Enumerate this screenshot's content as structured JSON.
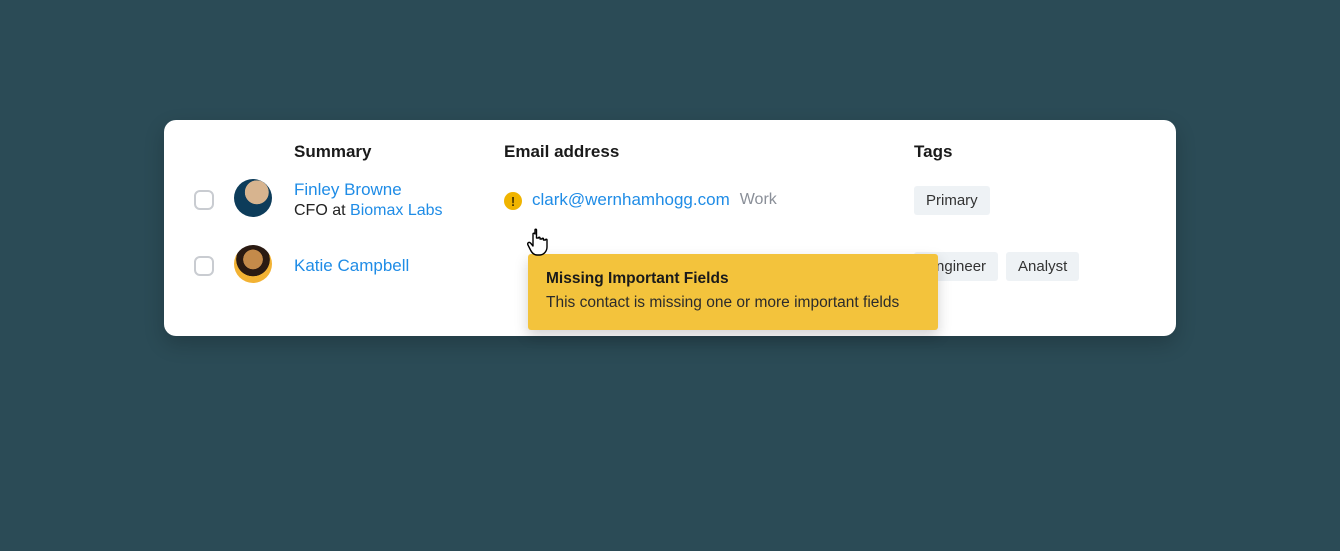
{
  "table": {
    "headers": {
      "summary": "Summary",
      "email": "Email address",
      "tags": "Tags"
    },
    "rows": [
      {
        "name": "Finley Browne",
        "role_prefix": "CFO at ",
        "company": "Biomax Labs",
        "email": "clark@wernhamhogg.com",
        "email_label": "Work",
        "warn": true,
        "tags": [
          "Primary"
        ]
      },
      {
        "name": "Katie Campbell",
        "role_prefix": "",
        "company": "",
        "email": "",
        "email_label": "",
        "warn": false,
        "tags": [
          "Engineer",
          "Analyst"
        ]
      }
    ]
  },
  "tooltip": {
    "title": "Missing Important Fields",
    "body": "This contact is missing one or more important fields"
  },
  "icons": {
    "warning_glyph": "!"
  }
}
